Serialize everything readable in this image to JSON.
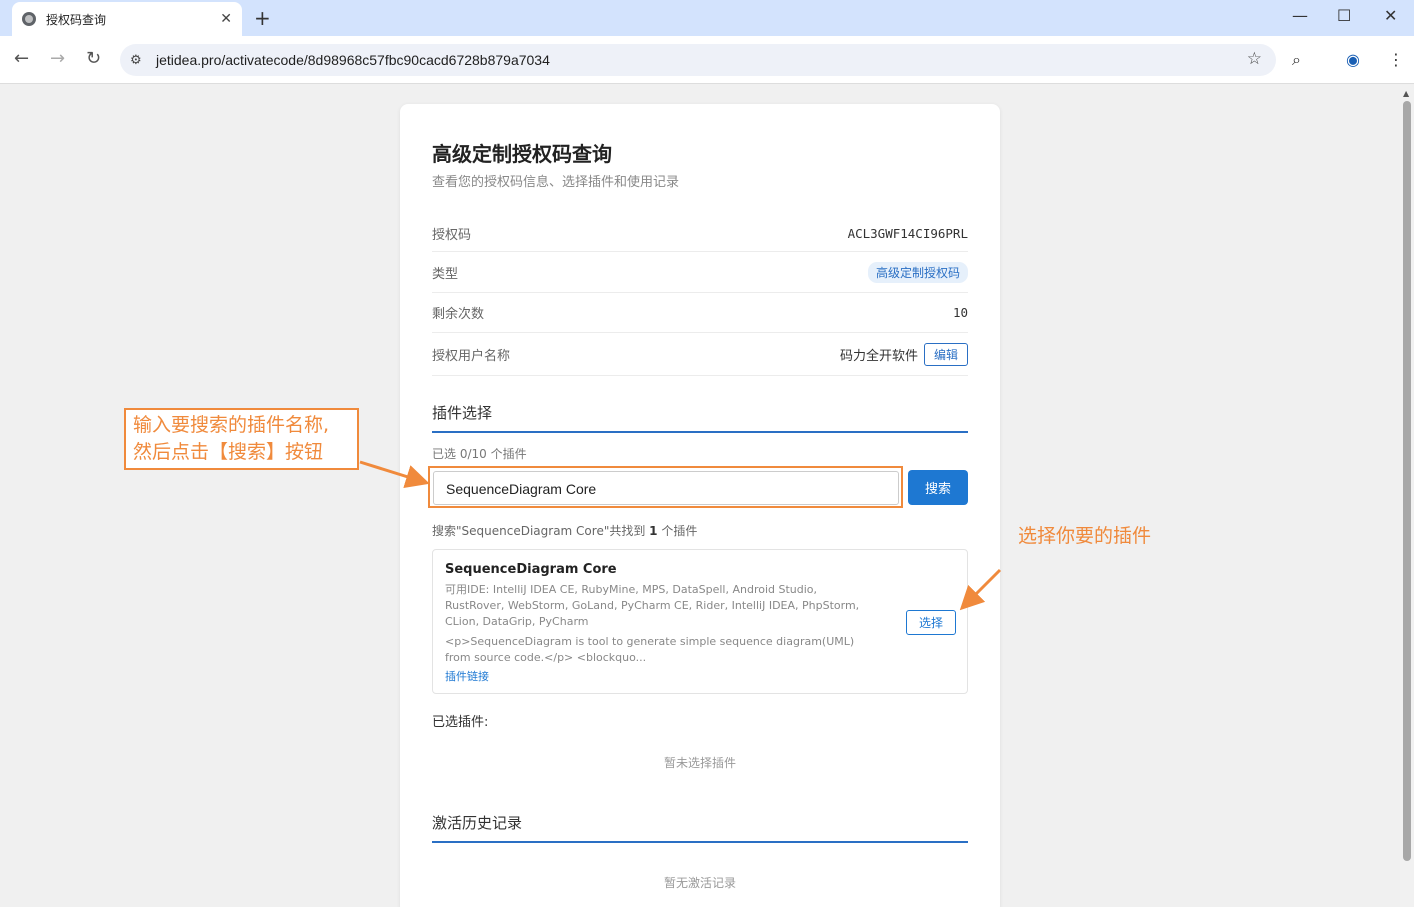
{
  "browser": {
    "tab_title": "授权码查询",
    "tab_close": "✕",
    "new_tab": "+",
    "url": "jetidea.pro/activatecode/8d98968c57fbc90cacd6728b879a7034",
    "minimize": "—",
    "maximize": "☐",
    "close": "✕"
  },
  "page": {
    "title": "高级定制授权码查询",
    "subtitle": "查看您的授权码信息、选择插件和使用记录",
    "info": [
      {
        "label": "授权码",
        "value": "ACL3GWF14CI96PRL"
      },
      {
        "label": "类型",
        "value": "高级定制授权码"
      },
      {
        "label": "剩余次数",
        "value": "10"
      },
      {
        "label": "授权用户名称",
        "value": "码力全开软件",
        "action": "编辑"
      }
    ],
    "plugin_section_title": "插件选择",
    "selected_count": "已选 0/10 个插件",
    "search_value": "SequenceDiagram Core",
    "search_button": "搜索",
    "result_prefix": "搜索\"SequenceDiagram Core\"共找到",
    "result_count": "1",
    "result_suffix": "个插件",
    "plugin": {
      "name": "SequenceDiagram Core",
      "ides": "可用IDE: IntelliJ IDEA CE, RubyMine, MPS, DataSpell, Android Studio, RustRover, WebStorm, GoLand, PyCharm CE, Rider, IntelliJ IDEA, PhpStorm, CLion, DataGrip, PyCharm",
      "description": "<p>SequenceDiagram is tool to generate simple sequence diagram(UML) from source code.</p> <blockquo...",
      "link": "插件链接",
      "select_button": "选择"
    },
    "selected_label": "已选插件:",
    "no_selection": "暂未选择插件",
    "history_title": "激活历史记录",
    "no_history": "暂无激活记录"
  },
  "annotations": {
    "left_line1": "输入要搜索的插件名称,",
    "left_line2": "然后点击【搜索】按钮",
    "right": "选择你要的插件"
  },
  "colors": {
    "accent": "#1e78d2",
    "annotation": "#f08a3c"
  }
}
